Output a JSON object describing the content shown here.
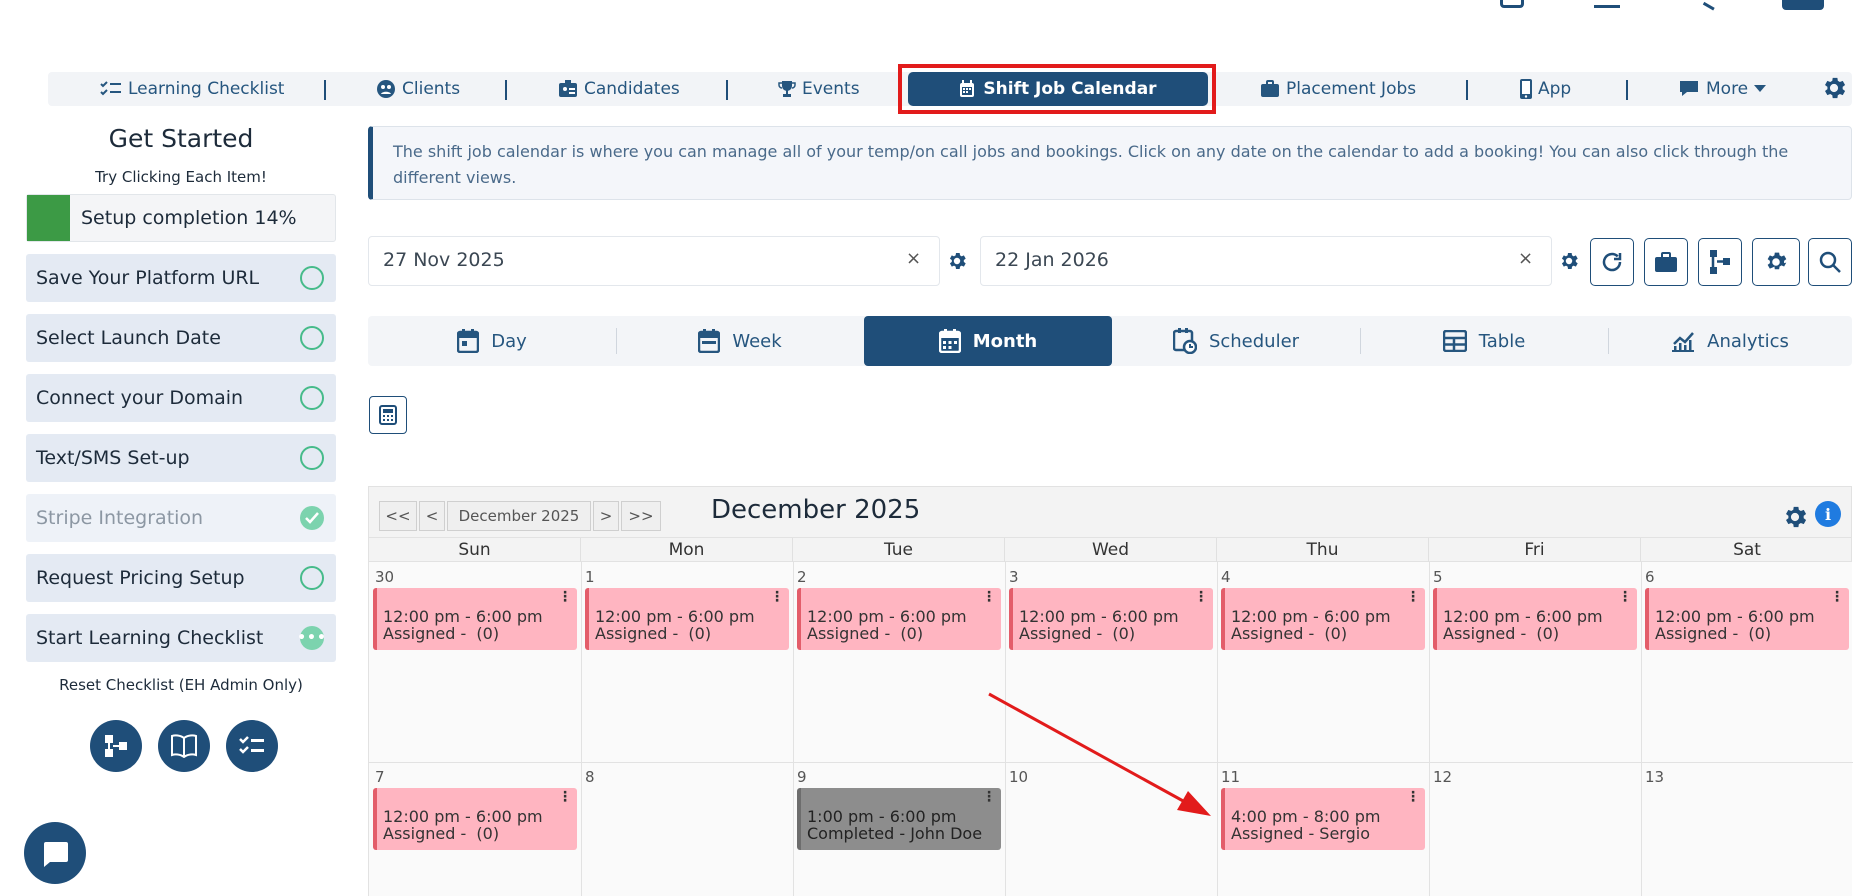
{
  "nav": {
    "items": [
      {
        "label": "Learning Checklist",
        "icon": "checklist-icon"
      },
      {
        "label": "Clients",
        "icon": "clients-icon"
      },
      {
        "label": "Candidates",
        "icon": "candidates-icon"
      },
      {
        "label": "Events",
        "icon": "trophy-icon"
      },
      {
        "label": "Shift Job Calendar",
        "icon": "calendar-icon",
        "active": true
      },
      {
        "label": "Placement Jobs",
        "icon": "briefcase-icon"
      },
      {
        "label": "App",
        "icon": "phone-icon"
      },
      {
        "label": "More",
        "icon": "chat-icon"
      }
    ]
  },
  "sidebar": {
    "title": "Get Started",
    "subtitle": "Try Clicking Each Item!",
    "progress_label": "Setup completion 14%",
    "progress_value": 0.14,
    "items": [
      {
        "label": "Save Your Platform URL",
        "status": "todo"
      },
      {
        "label": "Select Launch Date",
        "status": "todo"
      },
      {
        "label": "Connect your Domain",
        "status": "todo"
      },
      {
        "label": "Text/SMS Set-up",
        "status": "todo"
      },
      {
        "label": "Stripe Integration",
        "status": "done"
      },
      {
        "label": "Request Pricing Setup",
        "status": "todo"
      },
      {
        "label": "Start Learning Checklist",
        "status": "in-progress"
      }
    ],
    "reset_label": "Reset Checklist (EH Admin Only)"
  },
  "info_text": "The shift job calendar is where you can manage all of your temp/on call jobs and bookings. Click on any date on the calendar to add a booking! You can also click through the different views.",
  "filters": {
    "start_date": "27 Nov 2025",
    "end_date": "22 Jan 2026",
    "clear_symbol": "×"
  },
  "view_tabs": [
    {
      "label": "Day"
    },
    {
      "label": "Week"
    },
    {
      "label": "Month",
      "active": true
    },
    {
      "label": "Scheduler"
    },
    {
      "label": "Table"
    },
    {
      "label": "Analytics"
    }
  ],
  "calendar": {
    "nav_buttons": [
      "<<",
      "<",
      "December 2025",
      ">",
      ">>"
    ],
    "title": "December 2025",
    "info_symbol": "i",
    "days_of_week": [
      "Sun",
      "Mon",
      "Tue",
      "Wed",
      "Thu",
      "Fri",
      "Sat"
    ],
    "week1_days": [
      "30",
      "1",
      "2",
      "3",
      "4",
      "5",
      "6"
    ],
    "week2_days": [
      "7",
      "8",
      "9",
      "10",
      "11",
      "12",
      "13"
    ],
    "week1_events": [
      {
        "time": "12:00 pm - 6:00 pm",
        "status": "Assigned -  (0)"
      },
      {
        "time": "12:00 pm - 6:00 pm",
        "status": "Assigned -  (0)"
      },
      {
        "time": "12:00 pm - 6:00 pm",
        "status": "Assigned -  (0)"
      },
      {
        "time": "12:00 pm - 6:00 pm",
        "status": "Assigned -  (0)"
      },
      {
        "time": "12:00 pm - 6:00 pm",
        "status": "Assigned -  (0)"
      },
      {
        "time": "12:00 pm - 6:00 pm",
        "status": "Assigned -  (0)"
      },
      {
        "time": "12:00 pm - 6:00 pm",
        "status": "Assigned -  (0)"
      }
    ],
    "week2_events": {
      "sun": {
        "time": "12:00 pm - 6:00 pm",
        "status": "Assigned -  (0)"
      },
      "tue": {
        "time": "1:00 pm - 6:00 pm",
        "status": "Completed - John Doe"
      },
      "thu": {
        "time": "4:00 pm - 8:00 pm",
        "status": "Assigned - Sergio"
      }
    },
    "menu_symbol": "⋮"
  },
  "colors": {
    "brand": "#1f4e79",
    "event_pink": "#ffb5c1",
    "event_done": "#8d8d8d",
    "progress_green": "#3c9a45",
    "highlight_red": "#e21b1b"
  }
}
